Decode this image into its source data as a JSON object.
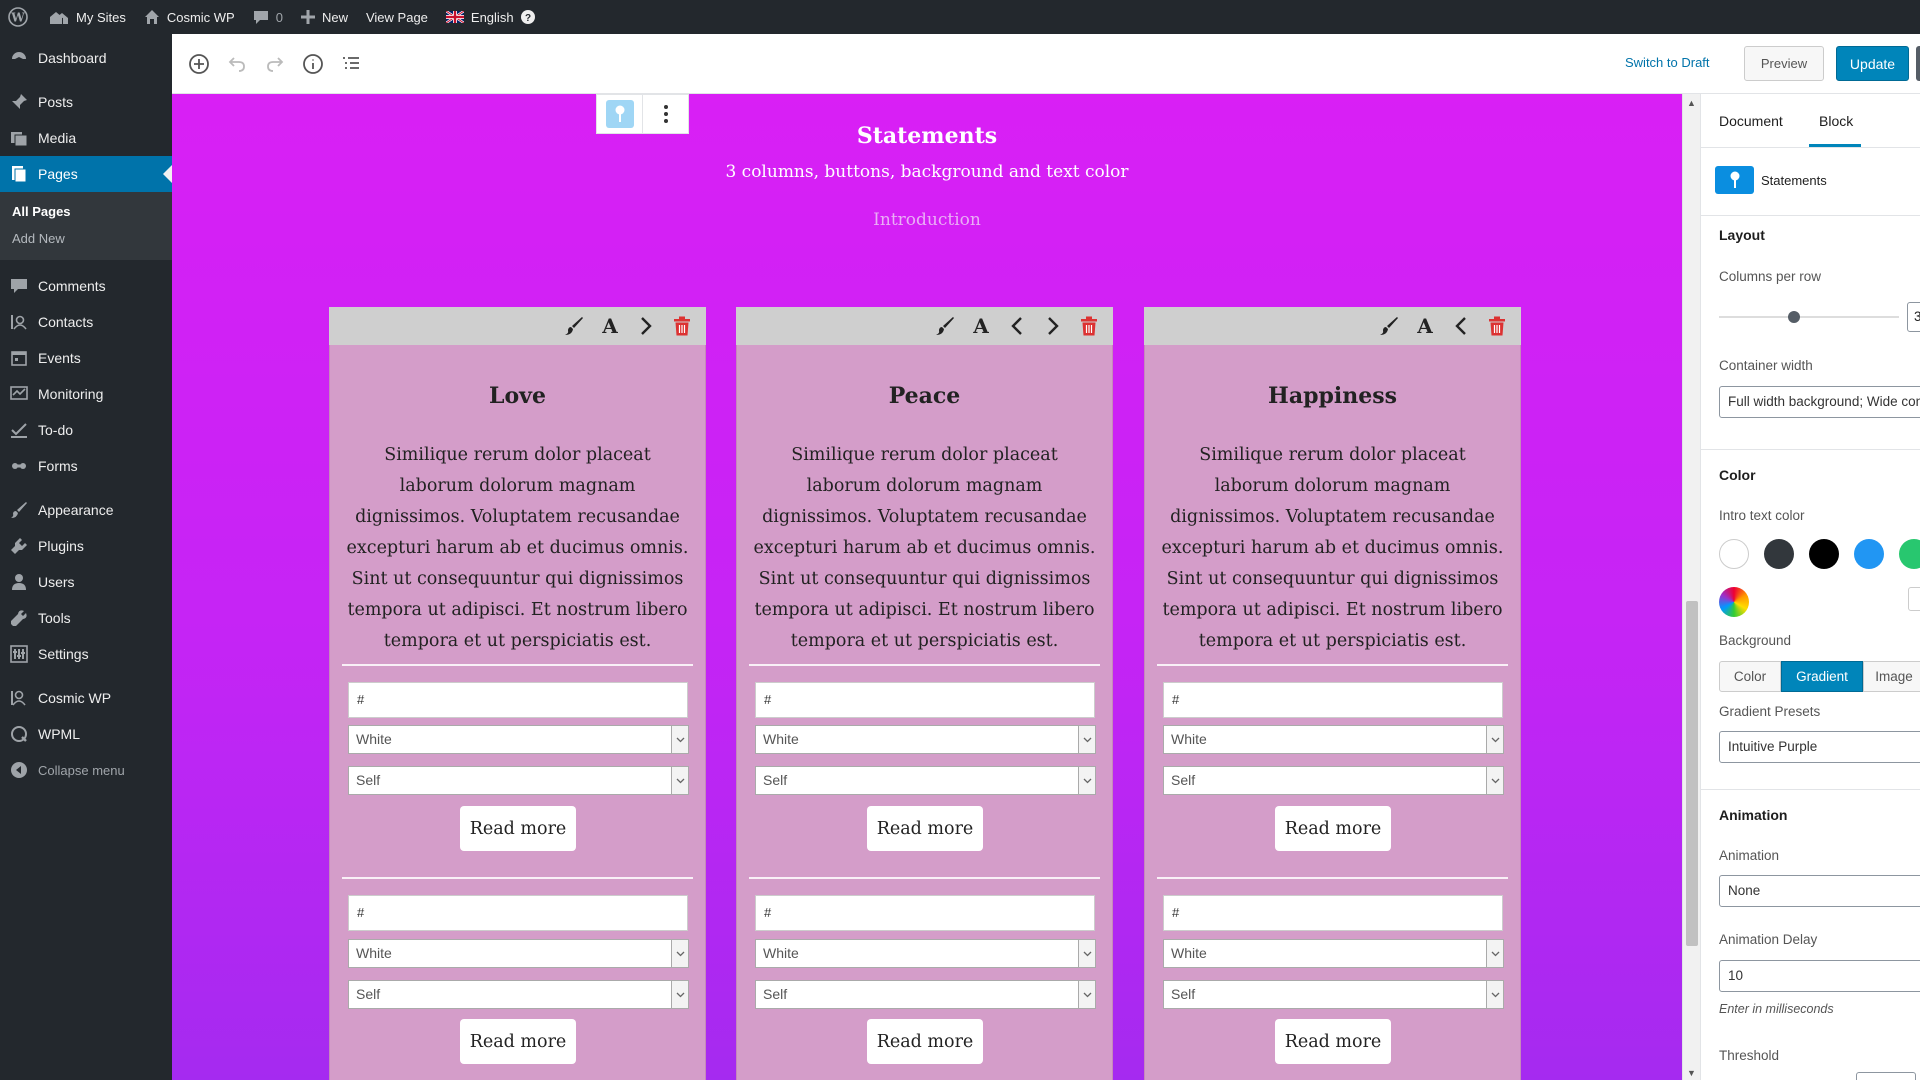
{
  "admin_bar": {
    "my_sites": "My Sites",
    "site_name": "Cosmic WP",
    "comments_count": "0",
    "new_label": "New",
    "view_page": "View Page",
    "language": "English"
  },
  "sidebar": {
    "items": [
      {
        "label": "Dashboard",
        "icon": "dashboard-icon"
      },
      {
        "label": "Posts",
        "icon": "pin-icon"
      },
      {
        "label": "Media",
        "icon": "media-icon"
      },
      {
        "label": "Pages",
        "icon": "page-icon"
      },
      {
        "label": "Comments",
        "icon": "comment-icon"
      },
      {
        "label": "Contacts",
        "icon": "contacts-icon"
      },
      {
        "label": "Events",
        "icon": "events-icon"
      },
      {
        "label": "Monitoring",
        "icon": "monitoring-icon"
      },
      {
        "label": "To-do",
        "icon": "todo-icon"
      },
      {
        "label": "Forms",
        "icon": "forms-icon"
      },
      {
        "label": "Appearance",
        "icon": "brush-icon"
      },
      {
        "label": "Plugins",
        "icon": "plugin-icon"
      },
      {
        "label": "Users",
        "icon": "user-icon"
      },
      {
        "label": "Tools",
        "icon": "wrench-icon"
      },
      {
        "label": "Settings",
        "icon": "settings-icon"
      },
      {
        "label": "Cosmic WP",
        "icon": "cosmic-icon"
      },
      {
        "label": "WPML",
        "icon": "wpml-icon"
      },
      {
        "label": "Collapse menu",
        "icon": "collapse-icon"
      }
    ],
    "submenu": {
      "all_pages": "All Pages",
      "add_new": "Add New"
    }
  },
  "header": {
    "switch_to_draft": "Switch to Draft",
    "preview": "Preview",
    "update": "Update"
  },
  "canvas": {
    "title": "Statements",
    "subtitle": "3 columns, buttons, background and text color",
    "intro_link": "Introduction",
    "columns": [
      {
        "title": "Love",
        "text": "Similique rerum dolor placeat laborum dolorum magnam dignissimos. Voluptatem recusandae excepturi harum ab et ducimus omnis. Sint ut consequuntur qui dignissimos tempora ut adipisci. Et nostrum libero tempora et ut perspiciatis est."
      },
      {
        "title": "Peace",
        "text": "Similique rerum dolor placeat laborum dolorum magnam dignissimos. Voluptatem recusandae excepturi harum ab et ducimus omnis. Sint ut consequuntur qui dignissimos tempora ut adipisci. Et nostrum libero tempora et ut perspiciatis est."
      },
      {
        "title": "Happiness",
        "text": "Similique rerum dolor placeat laborum dolorum magnam dignissimos. Voluptatem recusandae excepturi harum ab et ducimus omnis. Sint ut consequuntur qui dignissimos tempora ut adipisci. Et nostrum libero tempora et ut perspiciatis est."
      }
    ],
    "button_fields": {
      "url": "#",
      "color": "White",
      "target": "Self",
      "label": "Read more"
    }
  },
  "panel": {
    "tab_document": "Document",
    "tab_block": "Block",
    "block_name": "Statements",
    "layout_heading": "Layout",
    "columns_per_row_label": "Columns per row",
    "columns_per_row_value": "3",
    "container_width_label": "Container width",
    "container_width_value": "Full width background; Wide con",
    "color_heading": "Color",
    "intro_text_color_label": "Intro text color",
    "swatches": [
      "#ffffff",
      "#32373c",
      "#000000",
      "#2196f3",
      "#28c76f"
    ],
    "background_label": "Background",
    "bg_options": [
      "Color",
      "Gradient",
      "Image"
    ],
    "gradient_presets_label": "Gradient Presets",
    "gradient_preset_value": "Intuitive Purple",
    "animation_heading": "Animation",
    "animation_label": "Animation",
    "animation_value": "None",
    "animation_delay_label": "Animation Delay",
    "animation_delay_value": "10",
    "animation_delay_help": "Enter in milliseconds",
    "threshold_label": "Threshold"
  },
  "colors": {
    "accent": "#0085ba",
    "admin_dark": "#23282d",
    "canvas_gradient_top": "#d91ff5",
    "canvas_gradient_bottom": "#a52af0",
    "column_bg": "#d49dc9"
  }
}
